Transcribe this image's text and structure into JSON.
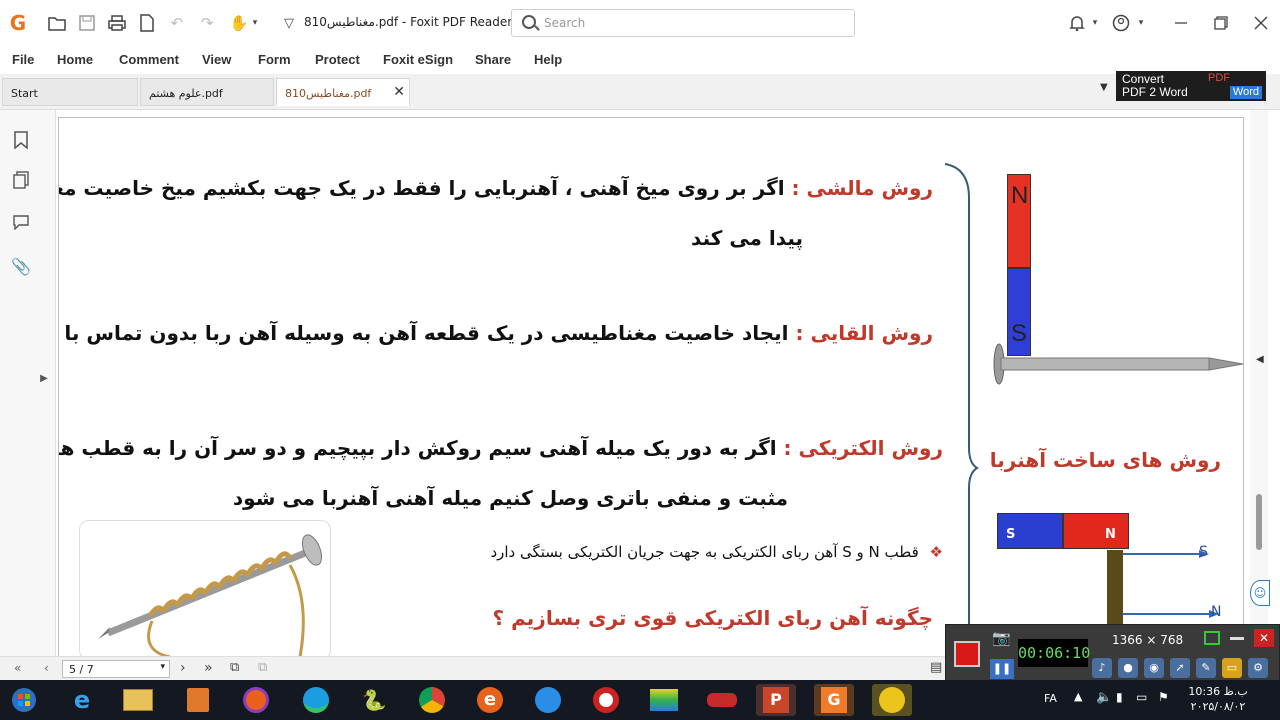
{
  "titlebar": {
    "doc_title": "810مغناطیس.pdf - Foxit PDF Reader",
    "search_placeholder": "Search"
  },
  "menu": [
    "File",
    "Home",
    "Comment",
    "View",
    "Form",
    "Protect",
    "Foxit eSign",
    "Share",
    "Help"
  ],
  "tabs": [
    {
      "label": "Start"
    },
    {
      "label": "علوم هشتم.pdf"
    },
    {
      "label": "810مغناطیس.pdf"
    }
  ],
  "convert_badge": {
    "line1": "Convert",
    "line2": "PDF 2 Word",
    "pdf": "PDF",
    "word": "Word"
  },
  "document": {
    "method1_label": "روش مالشی :",
    "method1_text_line1": "اگر بر روی میخ آهنی ، آهنربایی را فقط در یک جهت بکشیم میخ خاصیت مغناطیسی",
    "method1_text_line2": "پیدا می کند",
    "method2_label": "روش القایی :",
    "method2_text": "ایجاد خاصیت مغناطیسی در یک قطعه آهن به وسیله آهن ربا بدون تماس با آن",
    "method3_label": "روش الکتریکی :",
    "method3_text_line1": "اگر به دور یک میله آهنی سیم روکش دار بپیچیم و دو سر آن را به قطب های",
    "method3_text_line2": "مثبت و منفی باتری وصل کنیم میله آهنی آهنربا می شود",
    "bullet_text": "قطب N و S آهن ربای الکتریکی به جهت جریان الکتریکی بستگی دارد",
    "question": "چگونه آهن ربای الکتریکی قوی تری بسازیم ؟",
    "side_title": "روش های ساخت آهنربا",
    "magnet_n": "N",
    "magnet_s": "S",
    "bar_s": "S",
    "bar_n": "N",
    "arrow_s": "S",
    "arrow_n": "N"
  },
  "bottom": {
    "page_value": "5 / 7"
  },
  "recorder": {
    "resolution": "1366 × 768",
    "timer": "00:06:10"
  },
  "taskbar": {
    "lang": "FA",
    "time": "10:36 ب.ظ",
    "date": "۲۰۲۵/۰۸/۰۲"
  }
}
